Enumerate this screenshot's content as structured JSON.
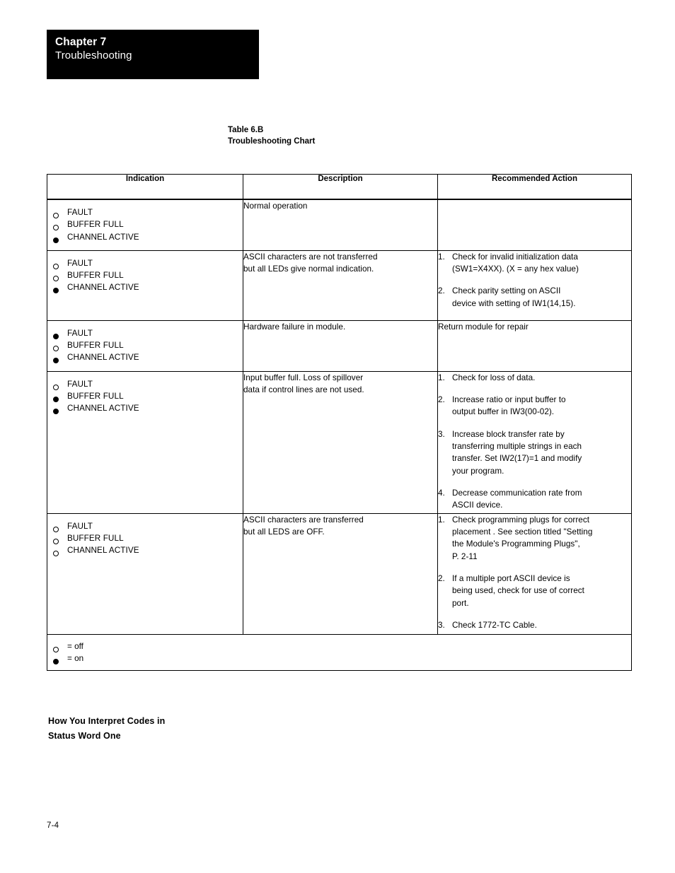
{
  "header": {
    "chapter_number": "Chapter 7",
    "chapter_title": "Troubleshooting"
  },
  "table_caption": {
    "line1": "Table 6.B",
    "line2": "Troubleshooting Chart"
  },
  "table": {
    "columns": [
      "Indication",
      "Description",
      "Recommended Action"
    ],
    "led_names": [
      "FAULT",
      "BUFFER FULL",
      "CHANNEL ACTIVE"
    ],
    "rows": [
      {
        "leds": [
          "off",
          "off",
          "on"
        ],
        "description": [
          "Normal operation"
        ],
        "actions": []
      },
      {
        "leds": [
          "off",
          "off",
          "on"
        ],
        "description": [
          "ASCII characters are not transferred",
          "but all LEDs give normal indication."
        ],
        "actions": [
          {
            "num": "1.",
            "lines": [
              "Check for invalid initialization data",
              "(SW1=X4XX). (X = any hex value)"
            ]
          },
          {
            "num": "2.",
            "lines": [
              "Check parity setting on ASCII",
              "device with setting of IW1(14,15)."
            ]
          }
        ]
      },
      {
        "leds": [
          "on",
          "off",
          "on"
        ],
        "description": [
          "Hardware failure in module."
        ],
        "actions_plain": [
          "Return module for repair"
        ],
        "actions": []
      },
      {
        "leds": [
          "off",
          "on",
          "on"
        ],
        "description": [
          "Input buffer full.  Loss of spillover",
          "data if control lines are not used."
        ],
        "actions": [
          {
            "num": "1.",
            "lines": [
              "Check for loss of data."
            ]
          },
          {
            "num": "2.",
            "lines": [
              "Increase ratio or input buffer to",
              "output buffer in IW3(00-02)."
            ]
          },
          {
            "num": "3.",
            "lines": [
              "Increase block transfer rate by",
              "transferring multiple strings in each",
              "transfer.  Set IW2(17)=1 and modify",
              "your program."
            ]
          },
          {
            "num": "4.",
            "lines": [
              "Decrease communication rate from",
              "ASCII device."
            ]
          }
        ]
      },
      {
        "leds": [
          "off",
          "off",
          "off"
        ],
        "description": [
          "ASCII characters are transferred",
          "but all LEDS are OFF."
        ],
        "actions": [
          {
            "num": "1.",
            "lines": [
              "Check programming plugs for correct",
              "placement .  See section titled \"Setting",
              " the Module's Programming Plugs\",",
              "P. 2-11"
            ]
          },
          {
            "num": "2.",
            "lines": [
              "If a multiple port ASCII device is",
              "being used, check for use of correct",
              "port."
            ]
          },
          {
            "num": "3.",
            "lines": [
              "Check 1772-TC Cable."
            ]
          }
        ]
      }
    ],
    "legend": [
      {
        "state": "off",
        "text": "=  off"
      },
      {
        "state": "on",
        "text": "=  on"
      }
    ]
  },
  "section_heading": {
    "line1": "How You Interpret Codes in",
    "line2": "Status Word One"
  },
  "page_number": "7-4"
}
